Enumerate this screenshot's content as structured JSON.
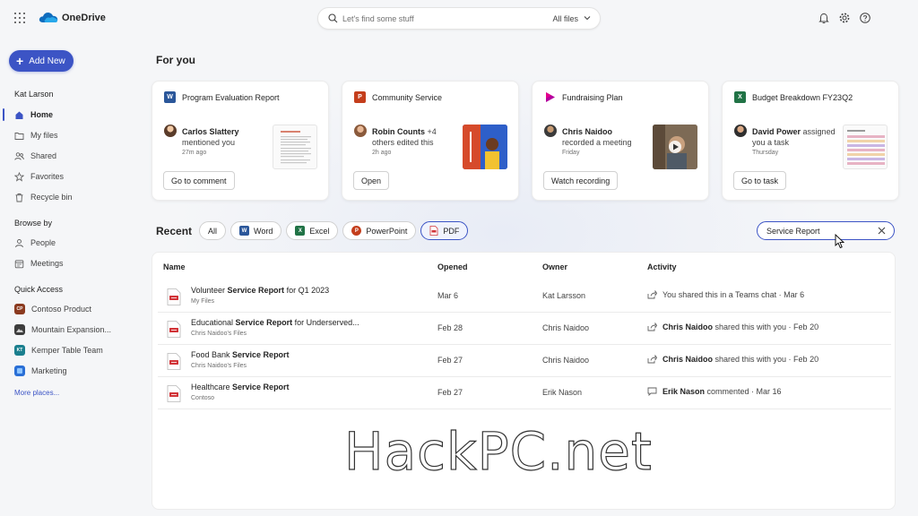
{
  "app": {
    "brand": "OneDrive",
    "search_placeholder": "Let's find some stuff",
    "search_scope": "All files"
  },
  "sidebar": {
    "add_new": "Add New",
    "user": "Kat Larson",
    "nav": [
      {
        "label": "Home",
        "icon": "home-icon",
        "active": true
      },
      {
        "label": "My files",
        "icon": "folder-icon"
      },
      {
        "label": "Shared",
        "icon": "people-icon"
      },
      {
        "label": "Favorites",
        "icon": "star-icon"
      },
      {
        "label": "Recycle bin",
        "icon": "trash-icon"
      }
    ],
    "browse_by_heading": "Browse by",
    "browse": [
      {
        "label": "People",
        "icon": "person-icon"
      },
      {
        "label": "Meetings",
        "icon": "calendar-icon"
      }
    ],
    "quick_access_heading": "Quick Access",
    "quick_access": [
      {
        "label": "Contoso Product",
        "badge": "CP",
        "color": "#8b3a1f"
      },
      {
        "label": "Mountain Expansion...",
        "badge": "",
        "color": "#3d3d3d"
      },
      {
        "label": "Kemper Table Team",
        "badge": "KT",
        "color": "#1a7f8e"
      },
      {
        "label": "Marketing",
        "badge": "",
        "color": "#2a6fd6"
      }
    ],
    "more_places": "More places..."
  },
  "for_you": {
    "heading": "For you",
    "cards": [
      {
        "title": "Program Evaluation Report",
        "app": "W",
        "app_color": "#2b579a",
        "person": "Carlos Slattery",
        "action": "mentioned you",
        "time": "27m ago",
        "button": "Go to comment"
      },
      {
        "title": "Community Service",
        "app": "P",
        "app_color": "#c43e1c",
        "person": "Robin Counts",
        "extra": "+4",
        "action": "others edited this",
        "time": "2h ago",
        "button": "Open"
      },
      {
        "title": "Fundraising Plan",
        "app": "",
        "app_color": "#b4009e",
        "person": "Chris Naidoo",
        "action": "recorded a meeting",
        "time": "Friday",
        "button": "Watch recording"
      },
      {
        "title": "Budget Breakdown FY23Q2",
        "app": "X",
        "app_color": "#217346",
        "person": "David Power",
        "action_inline": "assigned",
        "action": "you a task",
        "time": "Thursday",
        "button": "Go to task"
      }
    ]
  },
  "recent": {
    "heading": "Recent",
    "filters": [
      {
        "label": "All",
        "icon": ""
      },
      {
        "label": "Word",
        "icon": "W",
        "color": "#2b579a"
      },
      {
        "label": "Excel",
        "icon": "X",
        "color": "#217346"
      },
      {
        "label": "PowerPoint",
        "icon": "P",
        "color": "#c43e1c"
      },
      {
        "label": "PDF",
        "icon": "pdf",
        "color": "#d13438",
        "selected": true
      }
    ],
    "filter_value": "Service Report",
    "columns": {
      "name": "Name",
      "opened": "Opened",
      "owner": "Owner",
      "activity": "Activity"
    },
    "rows": [
      {
        "name_pre": "Volunteer ",
        "name_match": "Service Report",
        "name_post": " for Q1 2023",
        "location": "My Files",
        "opened": "Mar 6",
        "owner": "Kat Larsson",
        "act_icon": "share",
        "act_who": "",
        "act_text": "You shared this in a Teams chat · Mar 6"
      },
      {
        "name_pre": "Educational ",
        "name_match": "Service Report",
        "name_post": " for Underserved...",
        "location": "Chris Naidoo's Files",
        "opened": "Feb 28",
        "owner": "Chris Naidoo",
        "act_icon": "share",
        "act_who": "Chris Naidoo",
        "act_text": " shared this with you · Feb 20"
      },
      {
        "name_pre": "Food Bank ",
        "name_match": "Service Report",
        "name_post": "",
        "location": "Chris Naidoo's Files",
        "opened": "Feb 27",
        "owner": "Chris Naidoo",
        "act_icon": "share",
        "act_who": "Chris Naidoo",
        "act_text": " shared this with you · Feb 20"
      },
      {
        "name_pre": "Healthcare ",
        "name_match": "Service Report",
        "name_post": "",
        "location": "Contoso",
        "opened": "Feb 27",
        "owner": "Erik Nason",
        "act_icon": "comment",
        "act_who": "Erik Nason",
        "act_text": " commented · Mar 16"
      }
    ]
  },
  "watermark": "HackPC.net",
  "colors": {
    "accent": "#3c54c5",
    "pdf": "#d13438"
  }
}
